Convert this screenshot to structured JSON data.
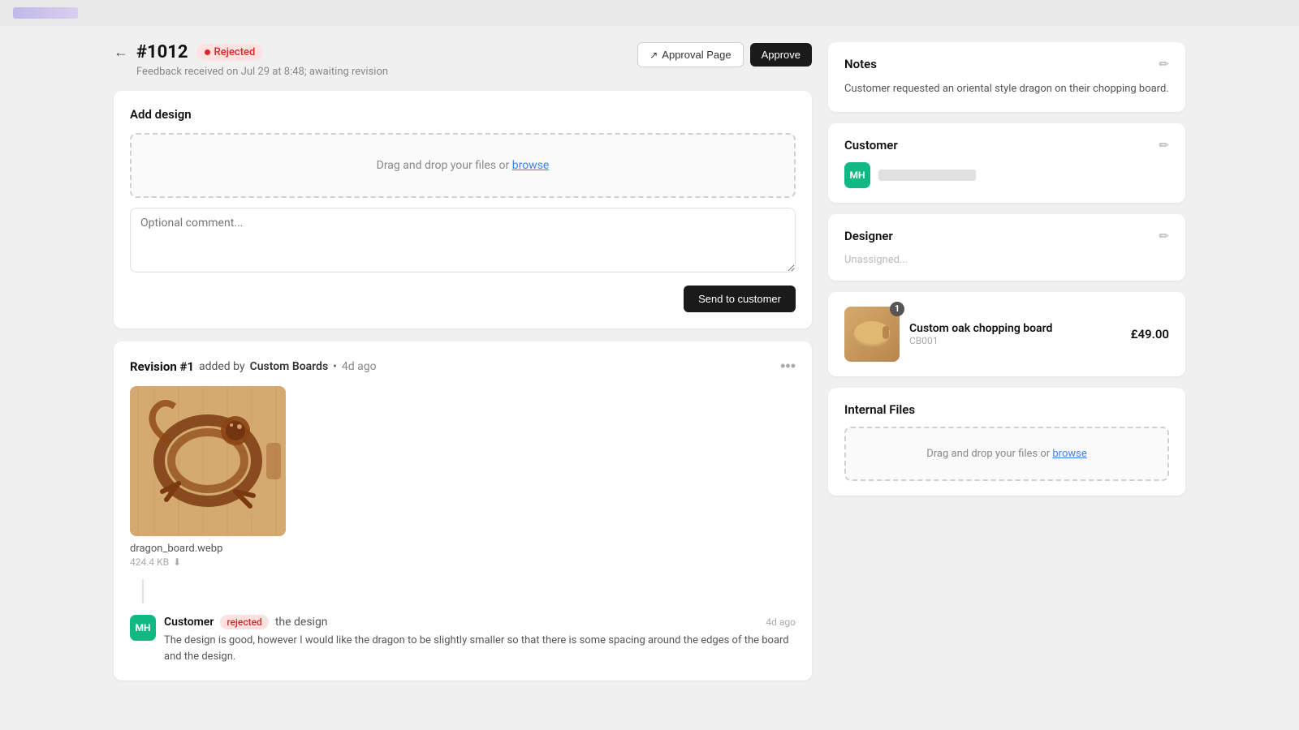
{
  "topbar": {
    "logo": ""
  },
  "header": {
    "order_number": "#1012",
    "status": "Rejected",
    "subtitle": "Feedback received on Jul 29 at 8:48; awaiting revision",
    "approval_page_label": "Approval Page",
    "approve_label": "Approve"
  },
  "add_design": {
    "title": "Add design",
    "dropzone_text": "Drag and drop your files or ",
    "dropzone_link": "browse",
    "comment_placeholder": "Optional comment...",
    "send_button": "Send to customer"
  },
  "revision": {
    "title": "Revision #1",
    "added_by_label": "added by",
    "added_by": "Custom Boards",
    "time": "4d ago",
    "file_name": "dragon_board.webp",
    "file_size": "424.4 KB",
    "comment": {
      "avatar": "MH",
      "commenter": "Customer",
      "action_badge": "rejected",
      "action_verb": "the design",
      "time": "4d ago",
      "text": "The design is good, however I would like the dragon to be slightly smaller so that there is some spacing around the edges of the board and the design."
    }
  },
  "notes": {
    "title": "Notes",
    "text": "Customer requested an oriental style dragon on their chopping board."
  },
  "customer": {
    "title": "Customer",
    "avatar": "MH"
  },
  "designer": {
    "title": "Designer",
    "unassigned": "Unassigned..."
  },
  "product": {
    "name": "Custom oak chopping board",
    "sku": "CB001",
    "price": "£49.00",
    "badge": "1"
  },
  "internal_files": {
    "title": "Internal Files",
    "dropzone_text": "Drag and drop your files or ",
    "dropzone_link": "browse"
  }
}
